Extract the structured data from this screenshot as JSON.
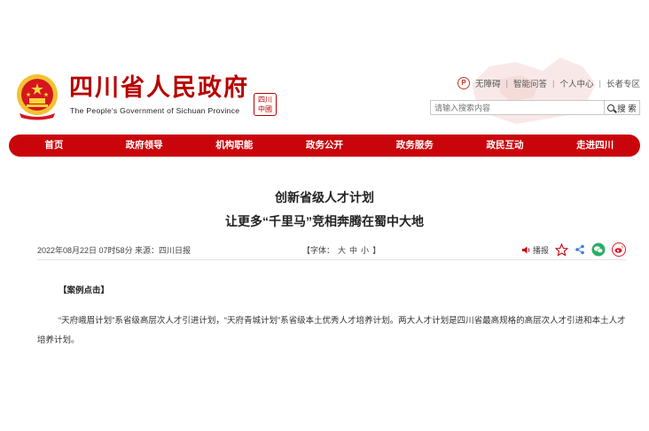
{
  "header": {
    "site_title": "四川省人民政府",
    "site_subtitle": "The People's Government of Sichuan Province",
    "seal_text": "四川中國",
    "top_links": [
      "无障碍",
      "智能问答",
      "个人中心",
      "长者专区"
    ],
    "search": {
      "placeholder": "请输入搜索内容",
      "button_label": "搜 索"
    }
  },
  "nav": {
    "items": [
      "首页",
      "政府领导",
      "机构职能",
      "政务公开",
      "政务服务",
      "政民互动",
      "走进四川"
    ]
  },
  "article": {
    "title_line1": "创新省级人才计划",
    "title_line2": "让更多“千里马”竞相奔腾在蜀中大地",
    "date": "2022年08月22日 07时58分",
    "source": "来源：四川日报",
    "font_size_label": "【字体：",
    "font_sizes": [
      "大",
      "中",
      "小"
    ],
    "font_size_close": "】",
    "play_label": "播报",
    "case_heading": "【案例点击】",
    "paragraph": "“天府峨眉计划”系省级高层次人才引进计划，“天府青城计划”系省级本土优秀人才培养计划。两大人才计划是四川省最高规格的高层次人才引进和本土人才培养计划。"
  },
  "colors": {
    "brand_red": "#c9050b",
    "title_red": "#b80000",
    "wechat_green": "#2aae67",
    "weibo_red": "#e6162d"
  },
  "icons": [
    "accessibility-icon",
    "search-icon",
    "speaker-icon",
    "star-icon",
    "share-icon",
    "wechat-icon",
    "weibo-icon",
    "national-emblem-icon"
  ]
}
